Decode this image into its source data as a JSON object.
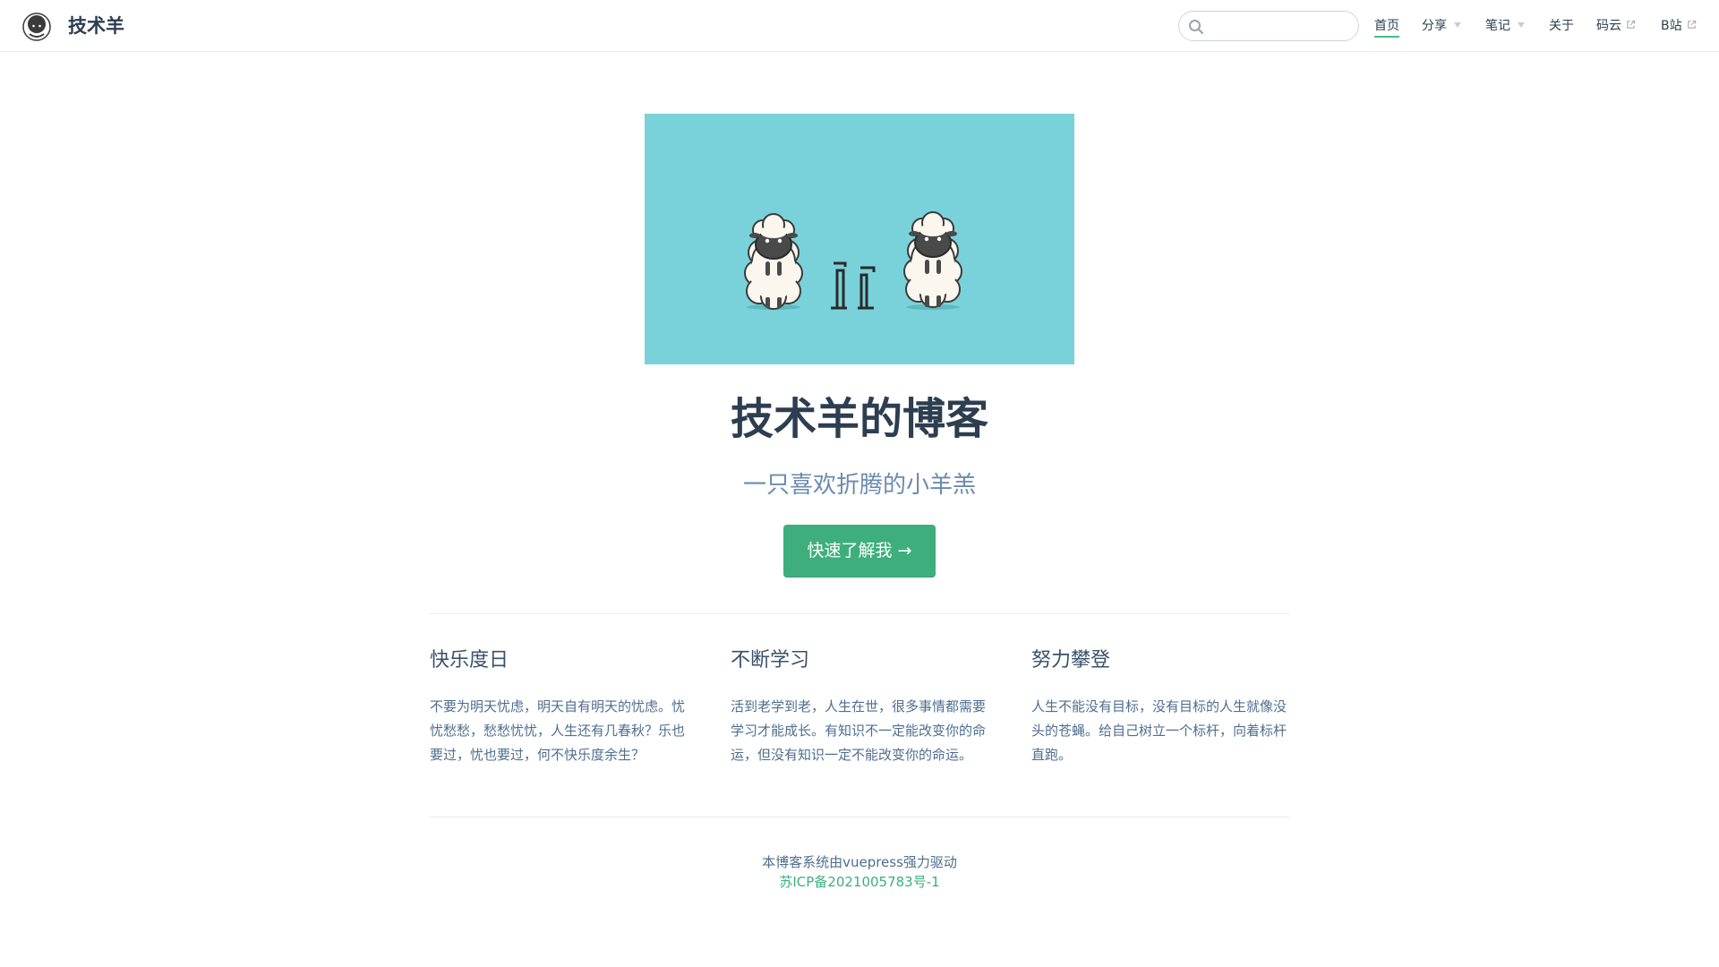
{
  "navbar": {
    "site_name": "技术羊",
    "logo_icon": "sheep-logo-icon",
    "search": {
      "value": "",
      "placeholder": ""
    },
    "items": [
      {
        "label": "首页",
        "active": true
      },
      {
        "label": "分享",
        "dropdown": true
      },
      {
        "label": "笔记",
        "dropdown": true
      },
      {
        "label": "关于"
      },
      {
        "label": "码云",
        "external": true
      },
      {
        "label": "B站",
        "external": true
      }
    ]
  },
  "hero": {
    "title": "技术羊的博客",
    "description": "一只喜欢折腾的小羊羔",
    "action_label": "快速了解我 →",
    "image_bg": "#79d2da"
  },
  "features": [
    {
      "title": "快乐度日",
      "details": "不要为明天忧虑，明天自有明天的忧虑。忧忧愁愁，愁愁忧忧，人生还有几春秋？乐也要过，忧也要过，何不快乐度余生？"
    },
    {
      "title": "不断学习",
      "details": "活到老学到老，人生在世，很多事情都需要学习才能成长。有知识不一定能改变你的命运，但没有知识一定不能改变你的命运。"
    },
    {
      "title": "努力攀登",
      "details": "人生不能没有目标，没有目标的人生就像没头的苍蝇。给自己树立一个标杆，向着标杆直跑。"
    }
  ],
  "footer": {
    "line1": "本博客系统由vuepress强力驱动",
    "icp": "苏ICP备2021005783号-1"
  },
  "colors": {
    "accent": "#3eaf7c",
    "text": "#2c3e50",
    "muted": "#6a8bad"
  }
}
